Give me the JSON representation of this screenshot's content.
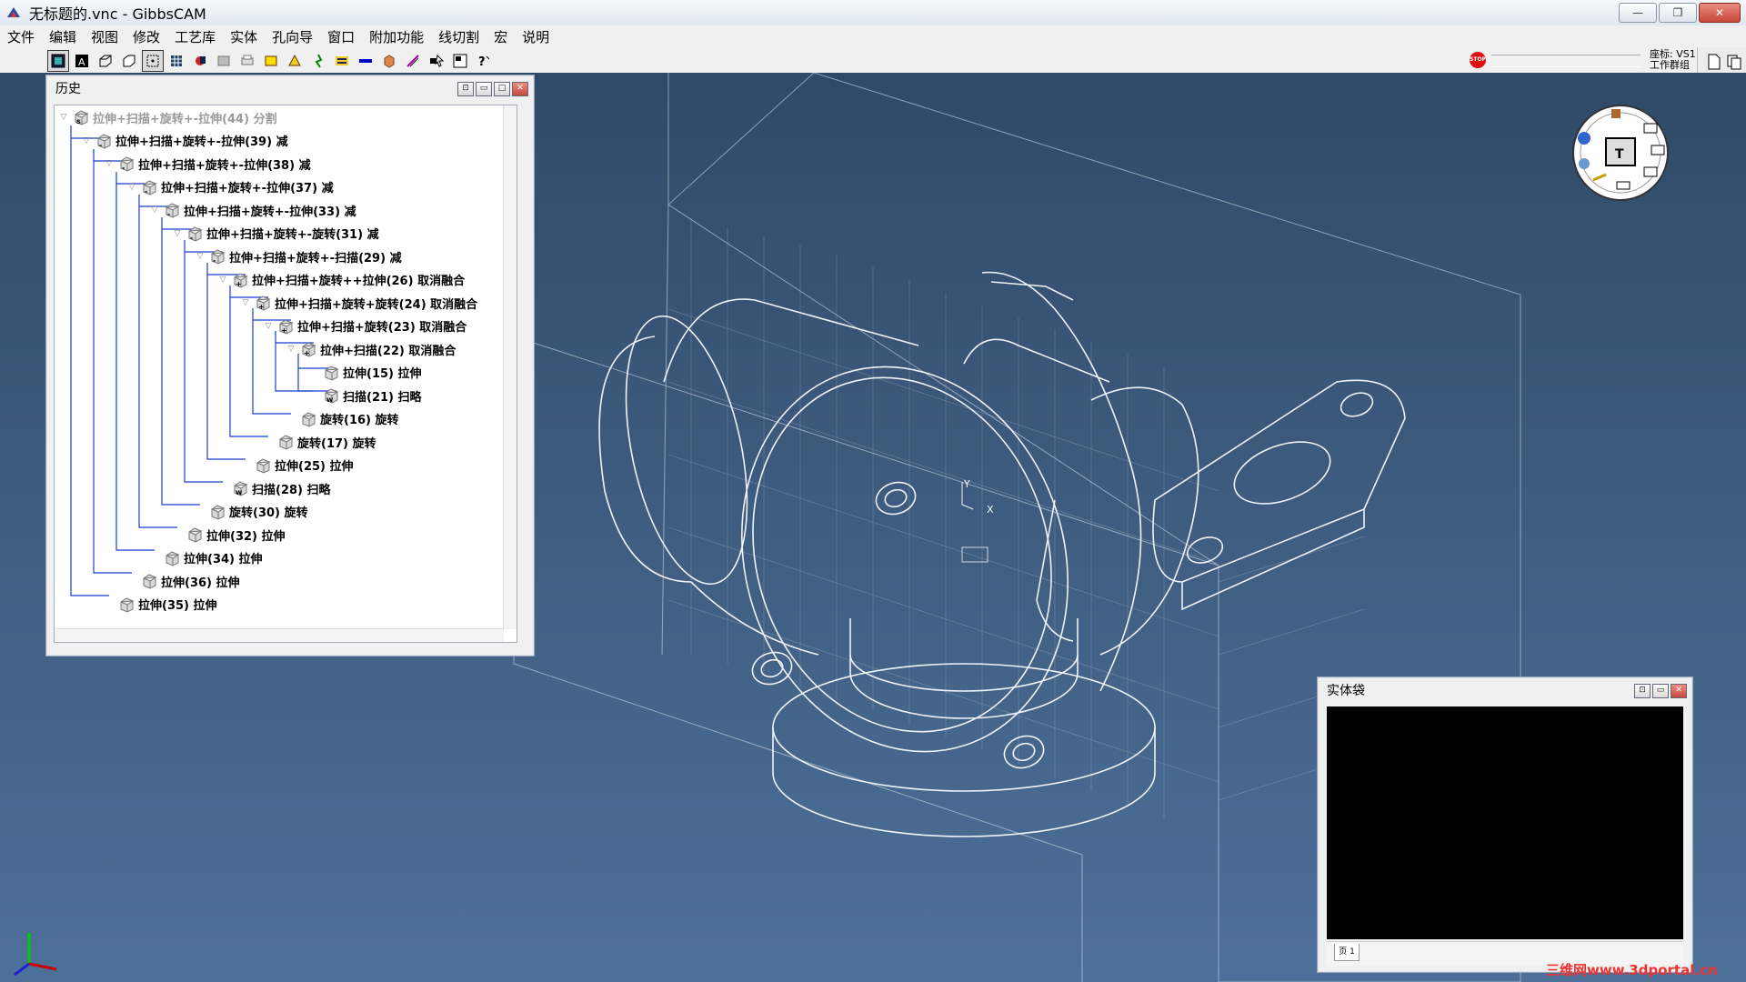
{
  "window": {
    "title": "无标题的.vnc - GibbsCAM",
    "minimize_glyph": "—",
    "restore_glyph": "❐",
    "close_glyph": "✕"
  },
  "menu": [
    "文件",
    "编辑",
    "视图",
    "修改",
    "工艺库",
    "实体",
    "孔向导",
    "窗口",
    "附加功能",
    "线切割",
    "宏",
    "说明"
  ],
  "toolbar": {
    "stop_label": "STOP",
    "coord_label": "座标: VS1",
    "workgroup_label": "工作群组"
  },
  "history_panel": {
    "title": "历史",
    "rows": [
      {
        "label": "拉伸+扫描+旋转+-拉伸(44) 分割",
        "dim": true,
        "icon": "s"
      },
      {
        "label": "拉伸+扫描+旋转+-拉伸(39) 减",
        "dim": false,
        "icon": "-"
      },
      {
        "label": "拉伸+扫描+旋转+-拉伸(38) 减",
        "dim": false,
        "icon": "-"
      },
      {
        "label": "拉伸+扫描+旋转+-拉伸(37) 减",
        "dim": false,
        "icon": "-"
      },
      {
        "label": "拉伸+扫描+旋转+-拉伸(33) 减",
        "dim": false,
        "icon": "-"
      },
      {
        "label": "拉伸+扫描+旋转+-旋转(31) 减",
        "dim": false,
        "icon": "-"
      },
      {
        "label": "拉伸+扫描+旋转+-扫描(29) 减",
        "dim": false,
        "icon": "-"
      },
      {
        "label": "拉伸+扫描+旋转++拉伸(26) 取消融合",
        "dim": false,
        "icon": "+"
      },
      {
        "label": "拉伸+扫描+旋转+旋转(24) 取消融合",
        "dim": false,
        "icon": "+"
      },
      {
        "label": "拉伸+扫描+旋转(23) 取消融合",
        "dim": false,
        "icon": "+"
      },
      {
        "label": "拉伸+扫描(22) 取消融合",
        "dim": false,
        "icon": "+"
      },
      {
        "label": "拉伸(15) 拉伸",
        "dim": false,
        "icon": ""
      },
      {
        "label": "扫描(21) 扫略",
        "dim": false,
        "icon": "w"
      },
      {
        "label": "旋转(16) 旋转",
        "dim": false,
        "icon": ""
      },
      {
        "label": "旋转(17) 旋转",
        "dim": false,
        "icon": ""
      },
      {
        "label": "拉伸(25) 拉伸",
        "dim": false,
        "icon": ""
      },
      {
        "label": "扫描(28) 扫略",
        "dim": false,
        "icon": "w"
      },
      {
        "label": "旋转(30) 旋转",
        "dim": false,
        "icon": ""
      },
      {
        "label": "拉伸(32) 拉伸",
        "dim": false,
        "icon": ""
      },
      {
        "label": "拉伸(34) 拉伸",
        "dim": false,
        "icon": ""
      },
      {
        "label": "拉伸(36) 拉伸",
        "dim": false,
        "icon": ""
      },
      {
        "label": "拉伸(35) 拉伸",
        "dim": false,
        "icon": ""
      }
    ]
  },
  "solid_bag_panel": {
    "title": "实体袋",
    "tab_label": "页 1"
  },
  "viewport": {
    "axis_x": "X",
    "axis_y": "Y",
    "background_top": "#2f4a68",
    "background_bottom": "#4d7099",
    "wire_color": "#e8eef5"
  },
  "watermark": "三维网www.3dportal.cn"
}
